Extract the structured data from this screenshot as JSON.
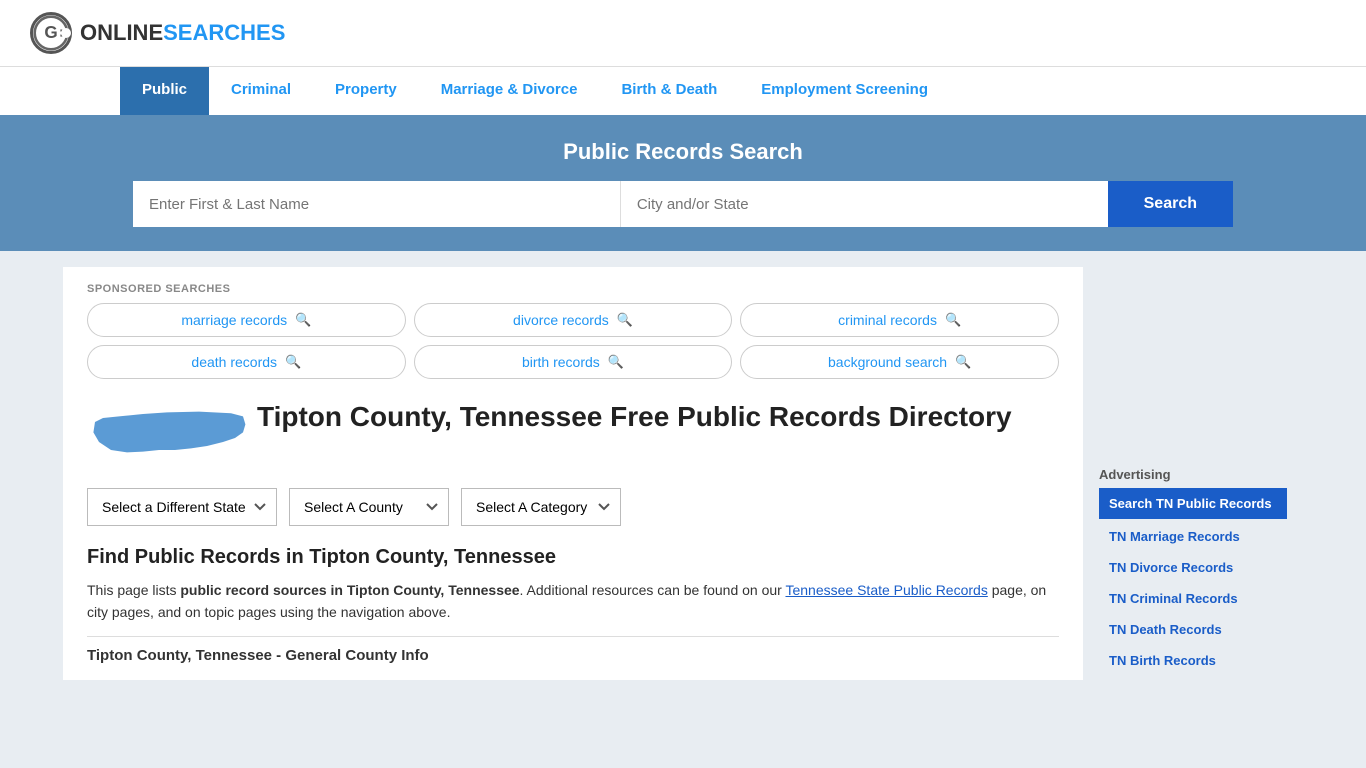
{
  "logo": {
    "icon_text": "G",
    "text_online": "ONLINE",
    "text_searches": "SEARCHES"
  },
  "nav": {
    "items": [
      {
        "label": "Public",
        "active": true
      },
      {
        "label": "Criminal",
        "active": false
      },
      {
        "label": "Property",
        "active": false
      },
      {
        "label": "Marriage & Divorce",
        "active": false
      },
      {
        "label": "Birth & Death",
        "active": false
      },
      {
        "label": "Employment Screening",
        "active": false
      }
    ]
  },
  "search_banner": {
    "title": "Public Records Search",
    "name_placeholder": "Enter First & Last Name",
    "location_placeholder": "City and/or State",
    "button_label": "Search"
  },
  "sponsored": {
    "label": "SPONSORED SEARCHES",
    "items": [
      {
        "label": "marriage records"
      },
      {
        "label": "divorce records"
      },
      {
        "label": "criminal records"
      },
      {
        "label": "death records"
      },
      {
        "label": "birth records"
      },
      {
        "label": "background search"
      }
    ]
  },
  "sidebar": {
    "advertising_label": "Advertising",
    "highlighted_item": "Search TN Public Records",
    "links": [
      {
        "label": "TN Marriage Records"
      },
      {
        "label": "TN Divorce Records"
      },
      {
        "label": "TN Criminal Records"
      },
      {
        "label": "TN Death Records"
      },
      {
        "label": "TN Birth Records"
      }
    ]
  },
  "county": {
    "title": "Tipton County, Tennessee Free Public Records Directory",
    "dropdowns": {
      "state": "Select a Different State",
      "county": "Select A County",
      "category": "Select A Category"
    },
    "find_title": "Find Public Records in Tipton County, Tennessee",
    "find_text_1": "This page lists ",
    "find_text_bold": "public record sources in Tipton County, Tennessee",
    "find_text_2": ". Additional resources can be found on our ",
    "find_link": "Tennessee State Public Records",
    "find_text_3": " page, on city pages, and on topic pages using the navigation above.",
    "general_info_title": "Tipton County, Tennessee - General County Info"
  }
}
